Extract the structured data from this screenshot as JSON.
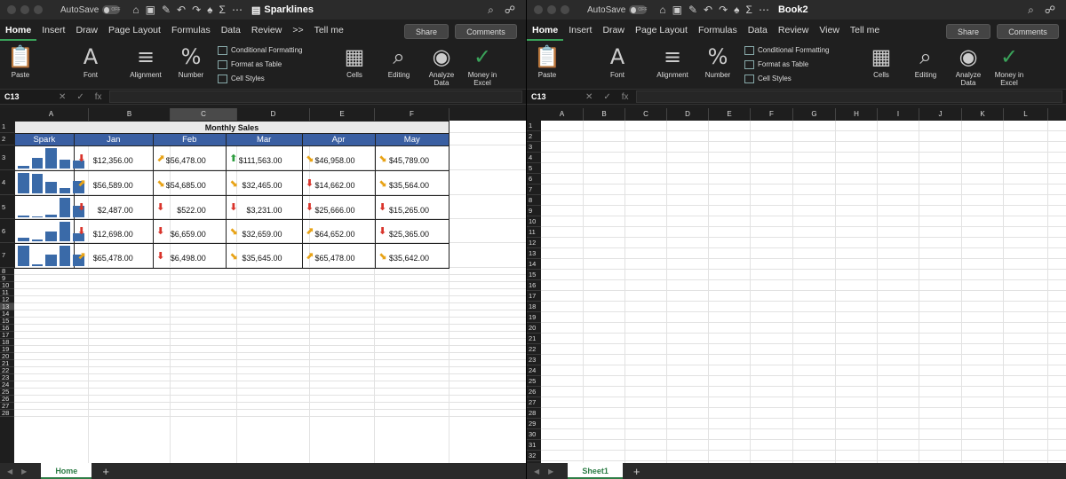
{
  "left": {
    "title": "Sparklines",
    "autosave_label": "AutoSave",
    "autosave_state": "OFF",
    "tabs": [
      "Home",
      "Insert",
      "Draw",
      "Page Layout",
      "Formulas",
      "Data",
      "Review",
      ">>",
      "Tell me"
    ],
    "share_label": "Share",
    "comments_label": "Comments",
    "ribbon": {
      "paste": "Paste",
      "font": "Font",
      "alignment": "Alignment",
      "number": "Number",
      "conditional_formatting": "Conditional Formatting",
      "format_as_table": "Format as Table",
      "cell_styles": "Cell Styles",
      "cells": "Cells",
      "editing": "Editing",
      "analyze_data": "Analyze Data",
      "money_in_excel": "Money in Excel"
    },
    "name_box": "C13",
    "columns": [
      "A",
      "B",
      "C",
      "D",
      "E",
      "F"
    ],
    "rows": [
      "1",
      "2",
      "3",
      "4",
      "5",
      "6",
      "7",
      "8",
      "9",
      "10",
      "11",
      "12",
      "13",
      "14",
      "15",
      "16",
      "17",
      "18",
      "19",
      "20",
      "21",
      "22",
      "23",
      "24",
      "25",
      "26",
      "27",
      "28"
    ],
    "sheet_tab": "Home",
    "table": {
      "title": "Monthly Sales",
      "headers": [
        "Spark",
        "Jan",
        "Feb",
        "Mar",
        "Apr",
        "May"
      ],
      "rows": [
        [
          {
            "v": "$12,356.00",
            "a": "down"
          },
          {
            "v": "$56,478.00",
            "a": "up-right"
          },
          {
            "v": "$111,563.00",
            "a": "up"
          },
          {
            "v": "$46,958.00",
            "a": "down-right"
          },
          {
            "v": "$45,789.00",
            "a": "down-right"
          }
        ],
        [
          {
            "v": "$56,589.00",
            "a": "up-right"
          },
          {
            "v": "$54,685.00",
            "a": "down-right"
          },
          {
            "v": "$32,465.00",
            "a": "down-right"
          },
          {
            "v": "$14,662.00",
            "a": "down"
          },
          {
            "v": "$35,564.00",
            "a": "down-right"
          }
        ],
        [
          {
            "v": "$2,487.00",
            "a": "down"
          },
          {
            "v": "$522.00",
            "a": "down"
          },
          {
            "v": "$3,231.00",
            "a": "down"
          },
          {
            "v": "$25,666.00",
            "a": "down"
          },
          {
            "v": "$15,265.00",
            "a": "down"
          }
        ],
        [
          {
            "v": "$12,698.00",
            "a": "down"
          },
          {
            "v": "$6,659.00",
            "a": "down"
          },
          {
            "v": "$32,659.00",
            "a": "down-right"
          },
          {
            "v": "$64,652.00",
            "a": "up-right"
          },
          {
            "v": "$25,365.00",
            "a": "down"
          }
        ],
        [
          {
            "v": "$65,478.00",
            "a": "up-right"
          },
          {
            "v": "$6,498.00",
            "a": "down"
          },
          {
            "v": "$35,645.00",
            "a": "down-right"
          },
          {
            "v": "$65,478.00",
            "a": "up-right"
          },
          {
            "v": "$35,642.00",
            "a": "down-right"
          }
        ]
      ]
    }
  },
  "right": {
    "title": "Book2",
    "autosave_label": "AutoSave",
    "autosave_state": "OFF",
    "tabs": [
      "Home",
      "Insert",
      "Draw",
      "Page Layout",
      "Formulas",
      "Data",
      "Review",
      "View",
      "Tell me"
    ],
    "share_label": "Share",
    "comments_label": "Comments",
    "ribbon": {
      "paste": "Paste",
      "font": "Font",
      "alignment": "Alignment",
      "number": "Number",
      "conditional_formatting": "Conditional Formatting",
      "format_as_table": "Format as Table",
      "cell_styles": "Cell Styles",
      "cells": "Cells",
      "editing": "Editing",
      "analyze_data": "Analyze Data",
      "money_in_excel": "Money in Excel"
    },
    "name_box": "C13",
    "columns": [
      "A",
      "B",
      "C",
      "D",
      "E",
      "F",
      "G",
      "H",
      "I",
      "J",
      "K",
      "L"
    ],
    "rows": [
      "1",
      "2",
      "3",
      "4",
      "5",
      "6",
      "7",
      "8",
      "9",
      "10",
      "11",
      "12",
      "13",
      "14",
      "15",
      "16",
      "17",
      "18",
      "19",
      "20",
      "21",
      "22",
      "23",
      "24",
      "25",
      "26",
      "27",
      "28",
      "29",
      "30",
      "31",
      "32"
    ],
    "sheet_tab": "Sheet1"
  },
  "colors": {
    "header_blue": "#3a5fa2",
    "sparkline_blue": "#3a6aa8",
    "arrow_red": "#d9342b",
    "arrow_orange": "#e8a317",
    "arrow_green": "#2e9d3f",
    "accent_green": "#2d7d46"
  }
}
